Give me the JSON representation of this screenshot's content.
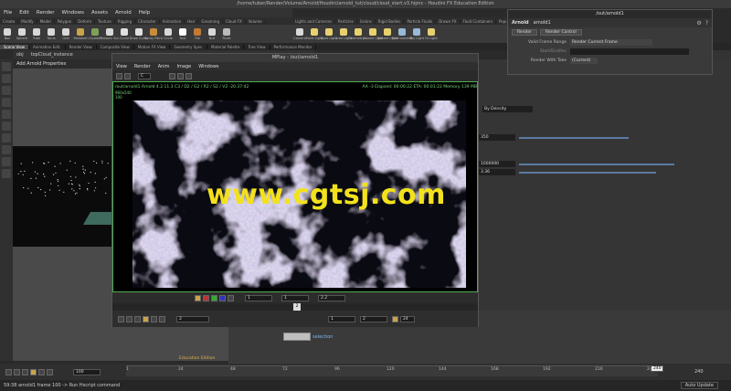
{
  "window": {
    "title": "/home/tuber/Render/Volume/Arnold/Houdini/arnold_tut/cloud/cloud_start.v3.hipnc - Houdini FX Education Edition"
  },
  "menu": [
    "File",
    "Edit",
    "Render",
    "Windows",
    "Assets",
    "Arnold",
    "Help"
  ],
  "shelf": {
    "tabs": [
      "Create",
      "Modify",
      "Model",
      "Polygon",
      "Deform",
      "Texture",
      "Rigging",
      "Character",
      "Animation",
      "Hair",
      "Grooming",
      "Cloud FX",
      "Volume"
    ],
    "tools": [
      {
        "label": "Box",
        "color": "#d8d8d8"
      },
      {
        "label": "Sphere",
        "color": "#d8d8d8"
      },
      {
        "label": "Tube",
        "color": "#d8d8d8"
      },
      {
        "label": "Torus",
        "color": "#d8d8d8"
      },
      {
        "label": "Grid",
        "color": "#d8d8d8"
      },
      {
        "label": "Metaball",
        "color": "#c9a44b"
      },
      {
        "label": "LSystem",
        "color": "#7da05a"
      },
      {
        "label": "Platonic Sol.",
        "color": "#d8d8d8"
      },
      {
        "label": "Curve",
        "color": "#e0e0e0"
      },
      {
        "label": "Draw Curve",
        "color": "#e0e0e0"
      },
      {
        "label": "Spray Paint",
        "color": "#c88d3a"
      },
      {
        "label": "Circle",
        "color": "#d8d8d8"
      },
      {
        "label": "Text",
        "color": "#ffffff"
      },
      {
        "label": "File",
        "color": "#c47a33"
      },
      {
        "label": "Null",
        "color": "#d8d8d8"
      },
      {
        "label": "Rivet",
        "color": "#bbbbbb"
      }
    ],
    "light_tabs": [
      "Lights and Cameras",
      "Particles",
      "Grains",
      "Rigid Bodies",
      "Particle Fluids",
      "Drawn FX",
      "Fluid Containers",
      "Populate Containers"
    ],
    "light_tools": [
      {
        "label": "Camera",
        "color": "#d8d8d8"
      },
      {
        "label": "Point Light",
        "color": "#e8d070"
      },
      {
        "label": "Spot Light",
        "color": "#e8d070"
      },
      {
        "label": "Area Light",
        "color": "#e8d070"
      },
      {
        "label": "Geometry L.",
        "color": "#e8d070"
      },
      {
        "label": "Volume Light",
        "color": "#e8d070"
      },
      {
        "label": "Distant Light",
        "color": "#e8d070"
      },
      {
        "label": "Environment",
        "color": "#9ab8d8"
      },
      {
        "label": "Sky Light",
        "color": "#9ab8d8"
      },
      {
        "label": "GI Light",
        "color": "#e8d070"
      }
    ]
  },
  "pane_tabs": [
    {
      "label": "Scene View",
      "active": true
    },
    {
      "label": "Animation Edit.",
      "active": false
    },
    {
      "label": "Render View",
      "active": false
    },
    {
      "label": "Composite View",
      "active": false
    },
    {
      "label": "Motion FX View",
      "active": false
    },
    {
      "label": "Geometry Spre.",
      "active": false
    },
    {
      "label": "Material Palette",
      "active": false
    },
    {
      "label": "Tree View",
      "active": false
    },
    {
      "label": "Performance Monitor",
      "active": false
    }
  ],
  "viewport": {
    "path": "obj",
    "node": "topCloud_instance",
    "title": "Add Arnold Properties"
  },
  "arnold_panel": {
    "title": "/out/arnold1",
    "node_type": "Arnold",
    "node_name": "arnold1",
    "render_button": "Render",
    "render_control_button": "Render Control",
    "valid_frame_range_label": "Valid Frame Range",
    "valid_frame_range_value": "Render Current Frame",
    "start_end_label": "Start/End/Inc",
    "render_with_take_label": "Render With Take",
    "render_with_take_value": "(Current)"
  },
  "params": {
    "density_mode": "By Density",
    "value1": "350",
    "value2": "1000000",
    "value3": "3.36"
  },
  "mplay": {
    "title": "MPlay - /out/arnold1",
    "menu": [
      "View",
      "Render",
      "Anim",
      "Image",
      "Windows"
    ],
    "info_left": "/out/arnold1   Arnold 4.2.11.3   C3 / D2 / G2 / R2 / S2 / V2 -20.37:42",
    "info_right": "AA -3   Elapsed: 00:00:22   ETA: 00:01:22   Memory  139 MB",
    "res": "960x540",
    "zoom": "100",
    "channel": "C",
    "frame_start": "1",
    "frame_end": "1",
    "gamma": "2.2",
    "frame": "2",
    "range_start": "1",
    "range_end": "2",
    "fps": "24"
  },
  "network": {
    "node_label": "selection",
    "edition": "Education Edition"
  },
  "timeline": {
    "current_frame": "100",
    "ticks": [
      "1",
      "24",
      "48",
      "72",
      "96",
      "120",
      "144",
      "168",
      "192",
      "216",
      "240"
    ],
    "end_frame": "240",
    "auto_update": "Auto Update"
  },
  "status": {
    "message": "59:38 arnold1 frame 100 -> Run Hscript command"
  },
  "watermark": "www.cgtsj.com"
}
